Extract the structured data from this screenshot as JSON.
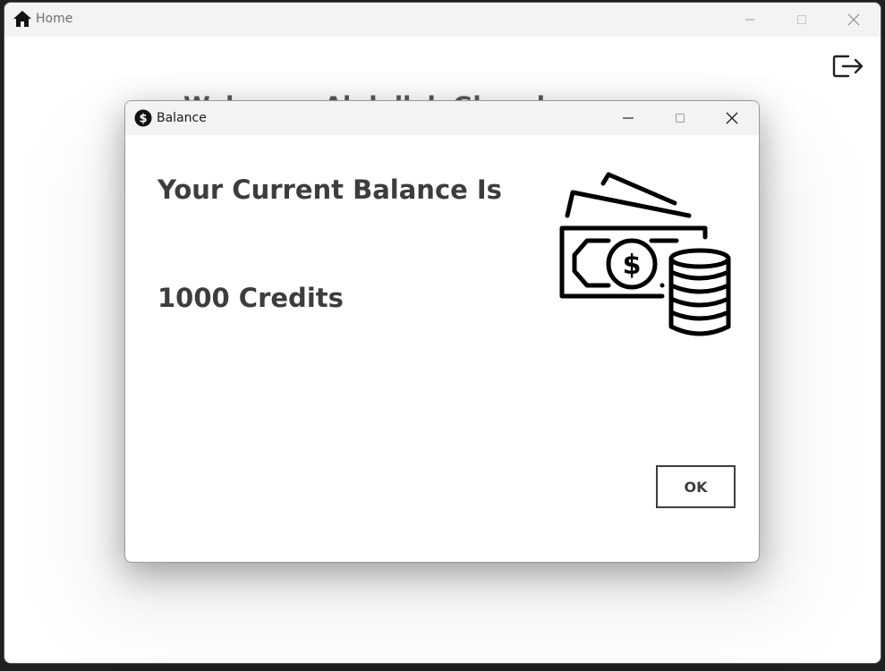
{
  "main_window": {
    "title": "Home",
    "app_icon": "home-icon",
    "background_heading": "Welcome, Abdullah Ghazal",
    "logout_icon": "logout-icon"
  },
  "dialog": {
    "title": "Balance",
    "app_icon": "dollar-coin-icon",
    "heading": "Your Current Balance Is",
    "balance": "1000 Credits",
    "illustration": "money-cash-coins-icon",
    "ok_label": "OK"
  },
  "colors": {
    "titlebar_bg": "#f3f3f3",
    "text_dark": "#3d3d3d",
    "title_gray": "#6e6e6e"
  }
}
